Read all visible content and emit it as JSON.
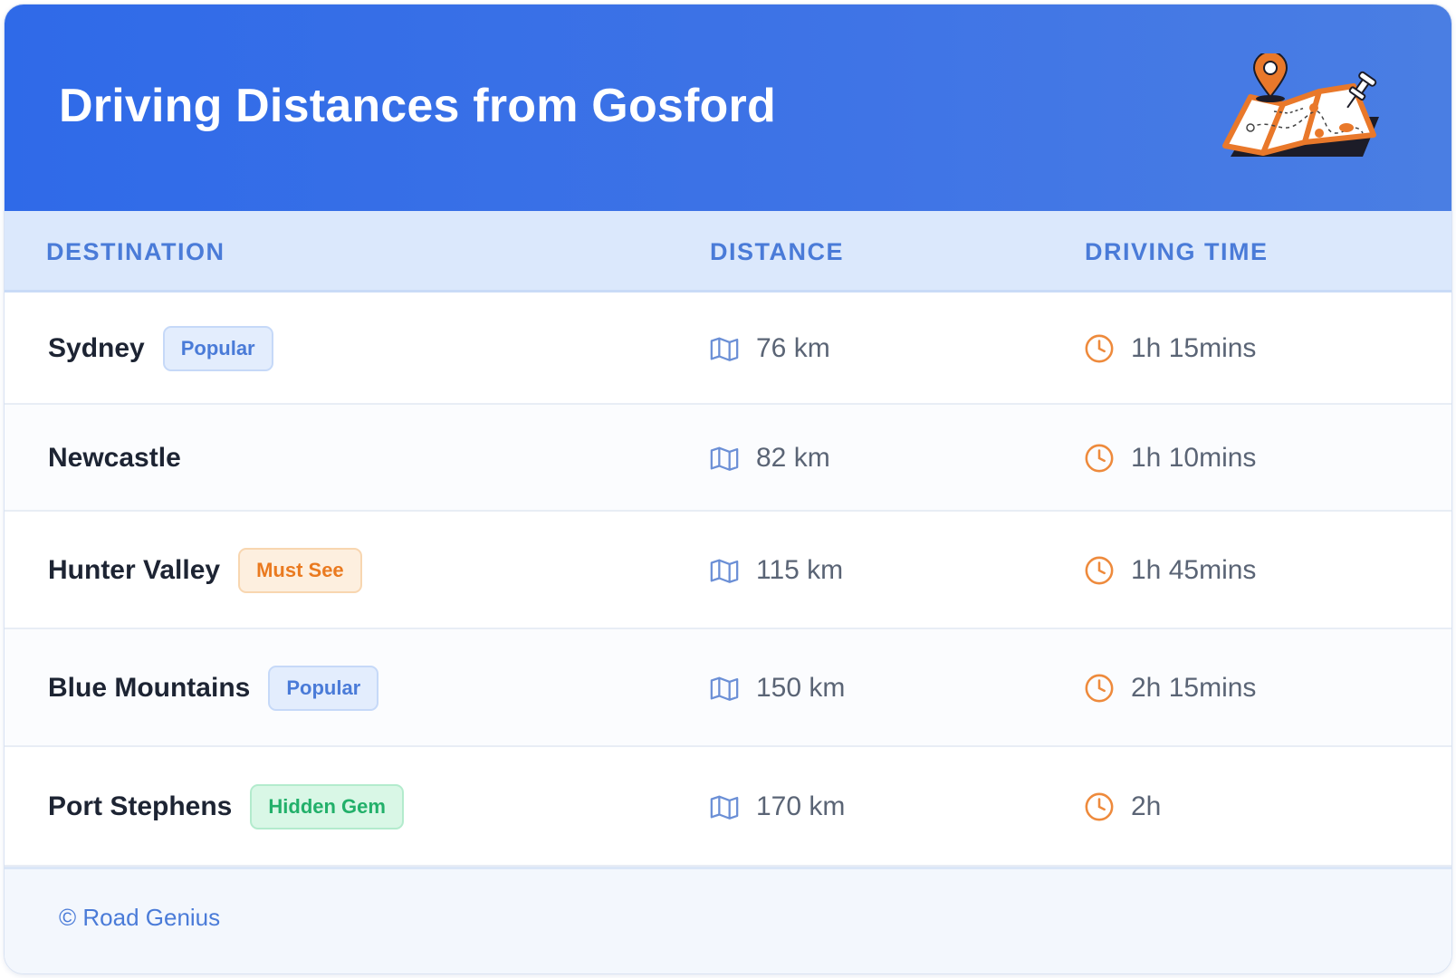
{
  "header": {
    "title": "Driving Distances from Gosford",
    "illustration_icon": "folded-map-with-pin-icon"
  },
  "table": {
    "columns": [
      "DESTINATION",
      "DISTANCE",
      "DRIVING TIME"
    ],
    "distance_icon": "map-icon",
    "time_icon": "clock-icon",
    "rows": [
      {
        "destination": "Sydney",
        "badge": "Popular",
        "badge_type": "popular",
        "distance": "76 km",
        "time": "1h 15mins"
      },
      {
        "destination": "Newcastle",
        "badge": "",
        "badge_type": "",
        "distance": "82 km",
        "time": "1h 10mins"
      },
      {
        "destination": "Hunter Valley",
        "badge": "Must See",
        "badge_type": "mustsee",
        "distance": "115 km",
        "time": "1h 45mins"
      },
      {
        "destination": "Blue Mountains",
        "badge": "Popular",
        "badge_type": "popular",
        "distance": "150 km",
        "time": "2h 15mins"
      },
      {
        "destination": "Port Stephens",
        "badge": "Hidden Gem",
        "badge_type": "gem",
        "distance": "170 km",
        "time": "2h"
      }
    ]
  },
  "footer": {
    "copyright": "© Road Genius"
  },
  "colors": {
    "header_gradient_start": "#2f6ae8",
    "header_gradient_end": "#4a7ee3",
    "accent_blue": "#4a7bd8",
    "accent_orange": "#ea7a20",
    "accent_green": "#22b06a",
    "table_head_bg": "#dbe8fc"
  }
}
